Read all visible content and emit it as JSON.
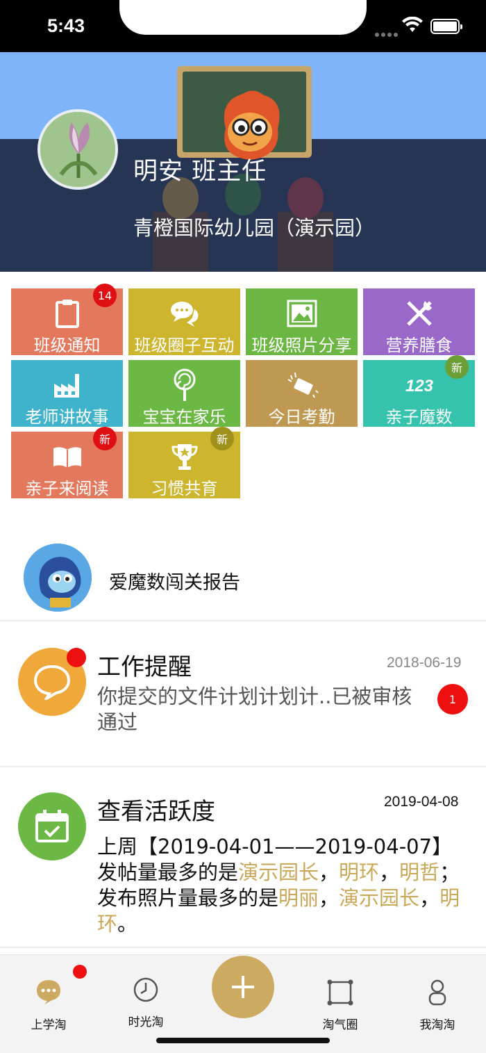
{
  "status_bar": {
    "time": "5:43"
  },
  "header": {
    "user_name": "明安  班主任",
    "school_name": "青橙国际幼儿园（演示园）"
  },
  "grid": [
    {
      "label": "班级通知",
      "color": "#e4785c",
      "icon": "clipboard-icon",
      "badge": "14",
      "badge_color": "red"
    },
    {
      "label": "班级圈子互动",
      "color": "#cdb52e",
      "icon": "chat-bubbles-icon"
    },
    {
      "label": "班级照片分享",
      "color": "#6cb644",
      "icon": "photo-icon"
    },
    {
      "label": "营养膳食",
      "color": "#9a68c8",
      "icon": "fork-knife-icon"
    },
    {
      "label": "老师讲故事",
      "color": "#3fb2cc",
      "icon": "factory-icon"
    },
    {
      "label": "宝宝在家乐",
      "color": "#6bb844",
      "icon": "lollipop-icon"
    },
    {
      "label": "今日考勤",
      "color": "#bf9952",
      "icon": "card-swipe-icon"
    },
    {
      "label": "亲子魔数",
      "color": "#35c3ad",
      "icon": "numbers-123-icon",
      "badge": "新",
      "badge_color": "green"
    },
    {
      "label": "亲子来阅读",
      "color": "#e4785c",
      "icon": "open-book-icon",
      "badge": "新",
      "badge_color": "red"
    },
    {
      "label": "习惯共育",
      "color": "#cdb52e",
      "icon": "trophy-icon",
      "badge": "新",
      "badge_color": "olive"
    }
  ],
  "magic_report": {
    "label": "爱魔数闯关报告"
  },
  "messages": [
    {
      "title": "工作提醒",
      "date": "2018-06-19",
      "body": "你提交的文件计划计划计..已被审核通过",
      "unread_count": "1",
      "icon_color": "#f0a83a"
    },
    {
      "title": "查看活跃度",
      "date": "2019-04-08",
      "icon_color": "#6bb844",
      "body_parts": {
        "line1": "上周【2019-04-01——2019-04-07】",
        "prefix": "发帖量最多的是",
        "name1": "演示园长",
        "sep1": "，",
        "name2": "明环",
        "sep2": "，",
        "name3": "明哲",
        "middle": "；发布照片量最多的是",
        "name4": "明丽",
        "sep3": "，",
        "name5": "演示园长",
        "sep4": "，",
        "name6": "明环",
        "end": "。"
      }
    }
  ],
  "tabbar": {
    "tabs": [
      {
        "label": "上学淘",
        "icon": "chat-bubble-icon"
      },
      {
        "label": "时光淘",
        "icon": "clock-icon"
      },
      {
        "label": "淘气圈",
        "icon": "square-frame-icon"
      },
      {
        "label": "我淘淘",
        "icon": "person-icon"
      }
    ],
    "accent": "#cdaa62"
  }
}
